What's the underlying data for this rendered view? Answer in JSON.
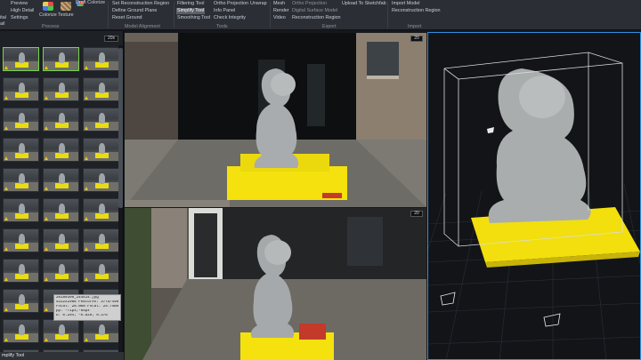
{
  "ribbon": {
    "left_partial": [
      "Preview",
      "High Detail",
      "Settings"
    ],
    "left_letters": [
      "ital",
      "ail"
    ],
    "colorize_label": "Colorize",
    "texture_label": "Texture",
    "draft_colorize_label": "Draft Colorize",
    "model_alignment": [
      "Set Reconstruction Region",
      "Define Ground Plane",
      "Reset Ground"
    ],
    "tools_col1": [
      "Filtering Tool",
      "Simplify Tool",
      "Smoothing Tool"
    ],
    "tools_col2": [
      "Ortho Projection",
      "Info Panel",
      "Check Integrity"
    ],
    "unwrap_label": "Unwrap",
    "export_col1": [
      "Mesh",
      "Render",
      "Video"
    ],
    "export_col2": [
      "Ortho Projection",
      "Digital Surface Model",
      "Reconstruction Region"
    ],
    "upload_label": "Upload To Sketchfab",
    "import_items": [
      "Import Model",
      "Reconstruction Region"
    ],
    "groups": [
      "Process",
      "Model Alignment",
      "Tools",
      "Export",
      "Import"
    ]
  },
  "left_panel": {
    "count_badge": "20x",
    "tooltip": [
      "20180306_144414.jpg",
      "5312x2988   Features: 3775/40000",
      "Focal: 28.0mm  Focal: 25.75mm",
      "       pp: -71px;-65px",
      "        D: 0.294; -0.820; 0.376"
    ],
    "tool_label": "mplify Tool"
  },
  "photo_top": {
    "badge": "20"
  },
  "photo_bottom": {
    "badge": "20"
  },
  "colors": {
    "accent": "#2f8fe0",
    "selected_thumb": "#7ad34d",
    "warning": "#f0c419",
    "box_yellow": "#f5e10e"
  }
}
